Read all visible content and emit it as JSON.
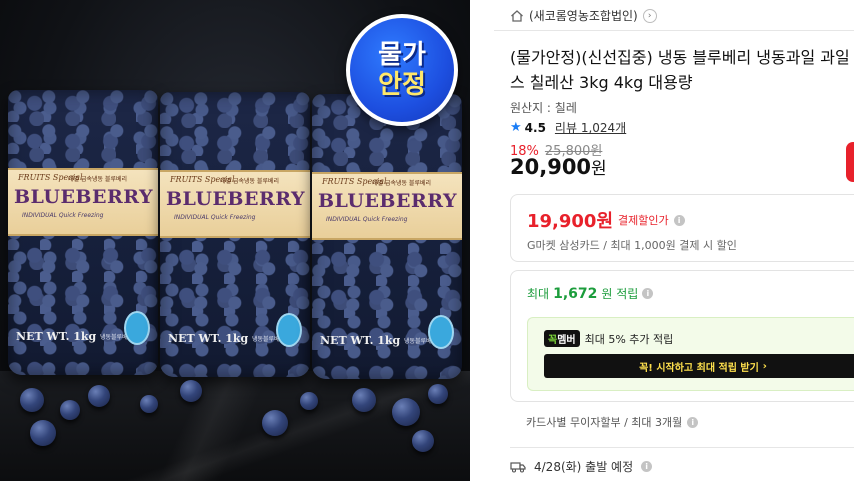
{
  "badge": {
    "line1": "물가",
    "line2": "안정"
  },
  "bag": {
    "brand": "FRUITS Special",
    "kor_small": "개별 급속냉동 블루베리",
    "title": "BLUEBERRY",
    "subtitle": "INDIVIDUAL Quick Freezing",
    "net": "NET WT. 1kg",
    "net_kor": "냉동블루베리"
  },
  "seller": {
    "name": "(새코롬영농조합법인)",
    "chevron": "›",
    "icon": "home-icon"
  },
  "product": {
    "title_line1": "(물가안정)(신선집중) 냉동 블루베리 냉동과일 과일",
    "title_line2": "스 칠레산 3kg 4kg 대용량",
    "origin": "원산지 : 칠레"
  },
  "rating": {
    "icon": "star-icon",
    "value": "4.5",
    "review_label": "리뷰 1,024개"
  },
  "price": {
    "discount": "18%",
    "original": "25,800원",
    "current_number": "20,900",
    "current_unit": "원"
  },
  "card_discount": {
    "price": "19,900원",
    "suffix": "결제할인가",
    "description": "G마켓 삼성카드 / 최대 1,000원 결제 시 할인"
  },
  "points": {
    "prefix": "최대",
    "amount": "1,672",
    "suffix": "원 적립"
  },
  "membership": {
    "tag1": "꼭",
    "tag2": "멤버",
    "description": "최대 5% 추가 적립",
    "button_label": "꼭! 시작하고 최대 적립 받기",
    "button_arrow": "›"
  },
  "installment": {
    "text": "카드사별 무이자할부 / 최대 3개월"
  },
  "shipping": {
    "icon": "truck-icon",
    "text": "4/28(화) 출발 예정"
  },
  "colors": {
    "accent_red": "#e8212b",
    "points_green": "#1c9d3c",
    "rating_blue": "#1a7cf5",
    "member_yellow": "#ffe14d"
  }
}
